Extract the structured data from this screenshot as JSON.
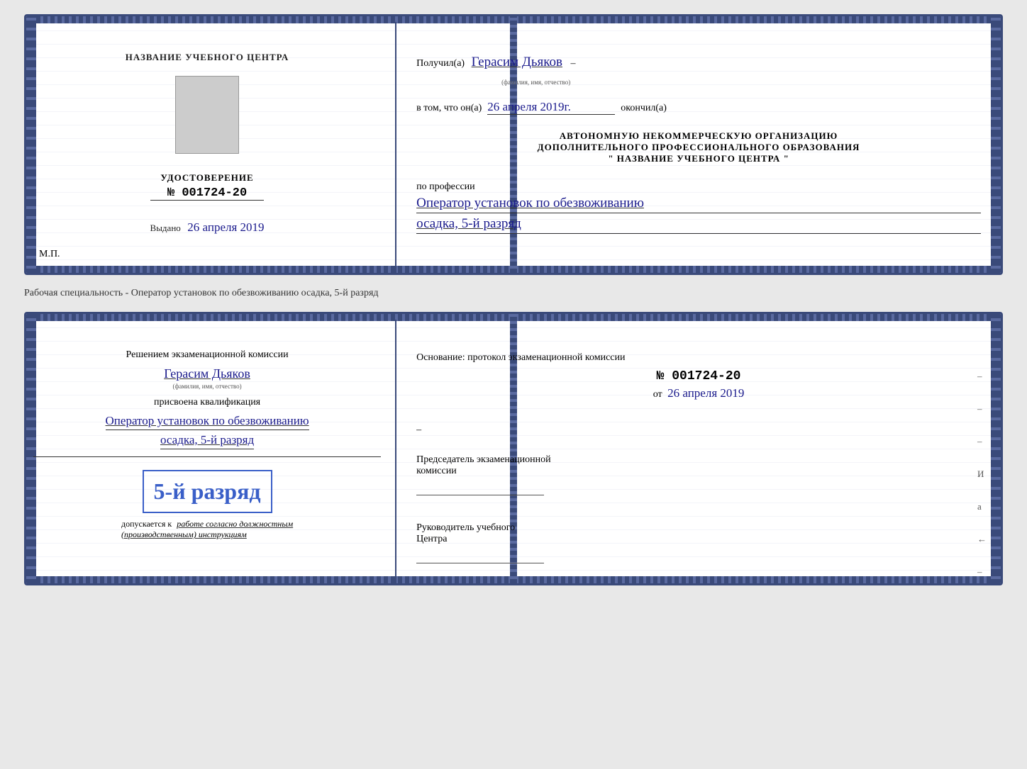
{
  "cert1": {
    "left": {
      "org_label": "НАЗВАНИЕ УЧЕБНОГО ЦЕНТРА",
      "doc_type": "УДОСТОВЕРЕНИЕ",
      "doc_number_prefix": "№",
      "doc_number": "001724-20",
      "issued_label": "Выдано",
      "issued_date": "26 апреля 2019",
      "mp_label": "М.П."
    },
    "right": {
      "received_label": "Получил(а)",
      "name": "Герасим Дьяков",
      "name_hint": "(фамилия, имя, отчество)",
      "dash": "–",
      "in_that": "в том, что он(а)",
      "date_completed": "26 апреля 2019г.",
      "completed_label": "окончил(а)",
      "org_line1": "АВТОНОМНУЮ НЕКОММЕРЧЕСКУЮ ОРГАНИЗАЦИЮ",
      "org_line2": "ДОПОЛНИТЕЛЬНОГО ПРОФЕССИОНАЛЬНОГО ОБРАЗОВАНИЯ",
      "org_line3": "\" НАЗВАНИЕ УЧЕБНОГО ЦЕНТРА \"",
      "profession_label": "по профессии",
      "profession_line1": "Оператор установок по обезвоживанию",
      "profession_line2": "осадка, 5-й разряд"
    }
  },
  "separator": {
    "text": "Рабочая специальность - Оператор установок по обезвоживанию осадка, 5-й разряд"
  },
  "cert2": {
    "left": {
      "decision_label": "Решением экзаменационной комиссии",
      "name": "Герасим Дьяков",
      "name_hint": "(фамилия, имя, отчество)",
      "qualification_assigned": "присвоена квалификация",
      "profession_line1": "Оператор установок по обезвоживанию",
      "profession_line2": "осадка, 5-й разряд",
      "rank_label": "5-й разряд",
      "admission_prefix": "допускается к",
      "admission_text": "работе согласно должностным",
      "admission_text2": "(производственным) инструкциям"
    },
    "right": {
      "basis_label": "Основание: протокол экзаменационной комиссии",
      "number_prefix": "№",
      "number": "001724-20",
      "date_prefix": "от",
      "date": "26 апреля 2019",
      "dash": "–",
      "chairman_label": "Председатель экзаменационной",
      "chairman_label2": "комиссии",
      "head_label": "Руководитель учебного",
      "head_label2": "Центра"
    }
  }
}
